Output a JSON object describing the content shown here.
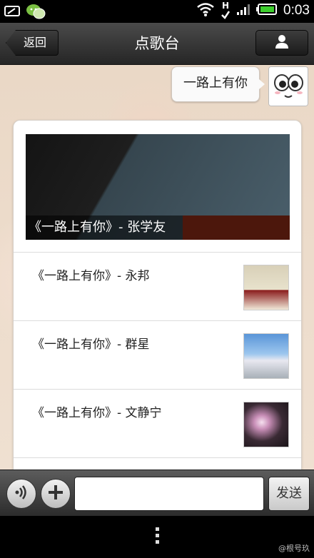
{
  "status_bar": {
    "time": "0:03",
    "network_letter": "H"
  },
  "header": {
    "back_label": "返回",
    "title": "点歌台"
  },
  "chat": {
    "sent_message": "一路上有你",
    "result_card": {
      "hero_caption": "《一路上有你》- 张学友",
      "songs": [
        {
          "title": "《一路上有你》- 永邦"
        },
        {
          "title": "《一路上有你》- 群星"
        },
        {
          "title": "《一路上有你》- 文静宁"
        }
      ]
    }
  },
  "input_bar": {
    "message_value": "",
    "send_label": "发送"
  },
  "watermark": "@根号玖",
  "colors": {
    "accent_orange": "#a9331c",
    "header_dark": "#262626",
    "battery_green": "#3ecf2e"
  }
}
